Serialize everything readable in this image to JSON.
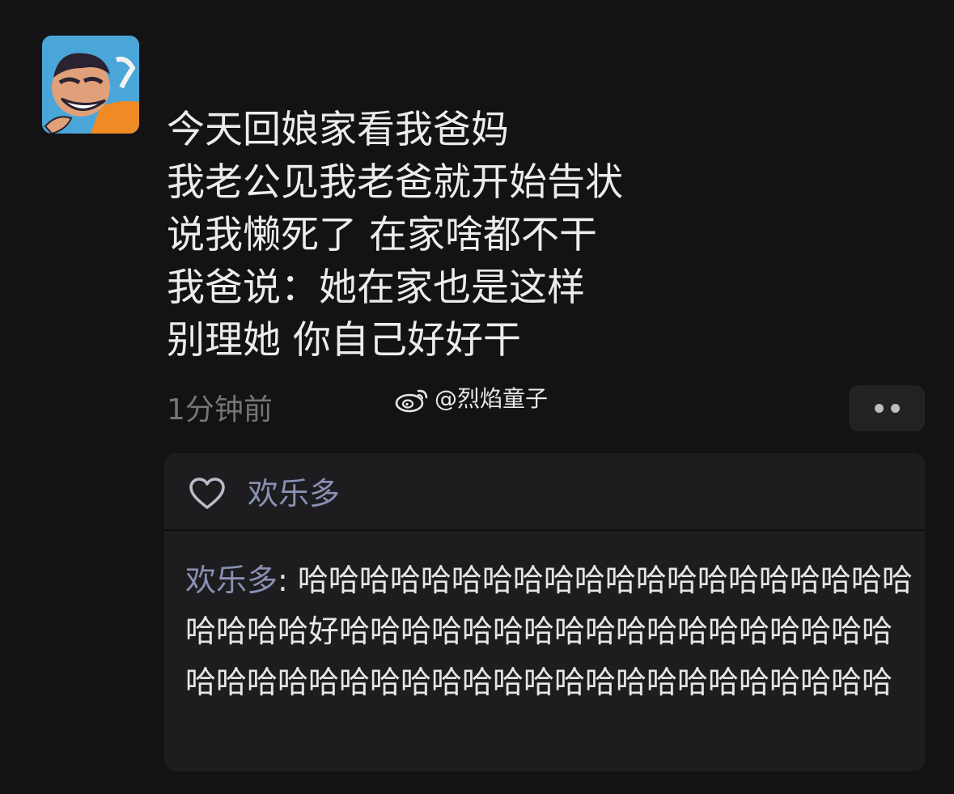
{
  "post": {
    "lines": [
      "今天回娘家看我爸妈",
      "我老公见我老爸就开始告状",
      "说我懒死了 在家啥都不干",
      "我爸说：她在家也是这样",
      "别理她 你自己好好干"
    ],
    "timestamp": "1分钟前"
  },
  "watermark": {
    "text": "@烈焰童子",
    "icon": "weibo-logo-icon"
  },
  "more_button": {
    "icon": "more-dots-icon"
  },
  "likes": {
    "icon": "heart-icon",
    "names": "欢乐多"
  },
  "comments": [
    {
      "author": "欢乐多",
      "separator": ": ",
      "text": "哈哈哈哈哈哈哈哈哈哈哈哈哈哈哈哈哈哈哈哈哈哈哈哈好哈哈哈哈哈哈哈哈哈哈哈哈哈哈哈哈哈哈哈哈哈哈哈哈哈哈哈哈哈哈哈哈哈哈哈哈哈哈哈哈哈"
    }
  ],
  "colors": {
    "background": "#131214",
    "panel": "#1d1c1f",
    "name_link": "#8891b2",
    "timestamp": "#757575"
  }
}
